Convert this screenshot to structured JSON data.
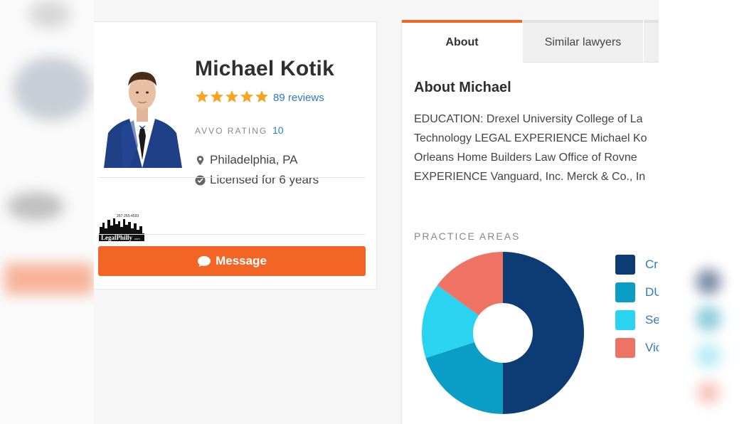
{
  "profile": {
    "name": "Michael Kotik",
    "reviews": "89 reviews",
    "rating_label": "AVVO RATING",
    "rating_value": "10",
    "location": "Philadelphia, PA",
    "licensed": "Licensed for 6 years",
    "photo_icon": "lawyer-portrait-photo",
    "logo_text": "LegalPhilly.com",
    "logo_phone": "267-265-4593",
    "message_label": "Message",
    "star_rating": 5,
    "star_color": "#f6a51f"
  },
  "tabs": [
    {
      "label": "About"
    },
    {
      "label": "Similar lawyers"
    }
  ],
  "about": {
    "title": "About Michael",
    "text": "EDUCATION: Drexel University College of La\nTechnology LEGAL EXPERIENCE Michael Ko\nOrleans Home Builders Law Office of Rovne\nEXPERIENCE Vanguard, Inc. Merck & Co., In"
  },
  "practice": {
    "title": "PRACTICE AREAS",
    "legend": [
      {
        "label": "Cri",
        "color": "#0d3b73"
      },
      {
        "label": "DU",
        "color": "#0a9ec6"
      },
      {
        "label": "Se",
        "color": "#2ad3f0"
      },
      {
        "label": "Vic",
        "color": "#ee7364"
      }
    ]
  },
  "chart_data": {
    "type": "pie",
    "title": "PRACTICE AREAS",
    "categories": [
      "Cri",
      "DU",
      "Se",
      "Vic"
    ],
    "values": [
      50,
      20,
      15,
      15
    ],
    "colors": [
      "#0d3b73",
      "#0a9ec6",
      "#2ad3f0",
      "#ee7364"
    ],
    "donut": true
  },
  "colors": {
    "accent": "#f26524",
    "link": "#2e7bbf"
  }
}
